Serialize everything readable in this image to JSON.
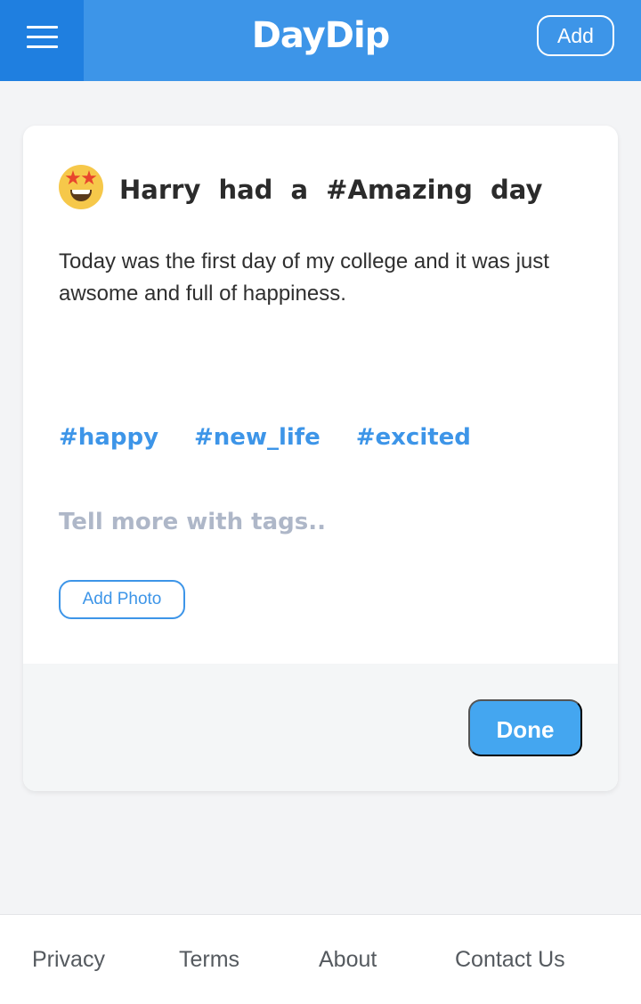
{
  "app": {
    "name": "DayDip"
  },
  "header": {
    "add_label": "Add"
  },
  "post": {
    "title": "Harry had a #Amazing day",
    "body": "Today was the first day of my college and it was just awsome and full of happiness.",
    "tags": [
      "#happy",
      "#new_life",
      "#excited"
    ],
    "tag_placeholder": "Tell more with tags..",
    "add_photo_label": "Add Photo",
    "done_label": "Done"
  },
  "footer": {
    "links": [
      "Privacy",
      "Terms",
      "About",
      "Contact Us"
    ]
  },
  "icons": {
    "menu": "hamburger-menu-icon",
    "mood": "star-struck-emoji-icon"
  },
  "colors": {
    "header_bg": "#3d95e8",
    "menu_bg": "#1f7fe0",
    "accent": "#3d95e8",
    "done_bg": "#44a6f0",
    "placeholder": "#aeb7c8"
  }
}
